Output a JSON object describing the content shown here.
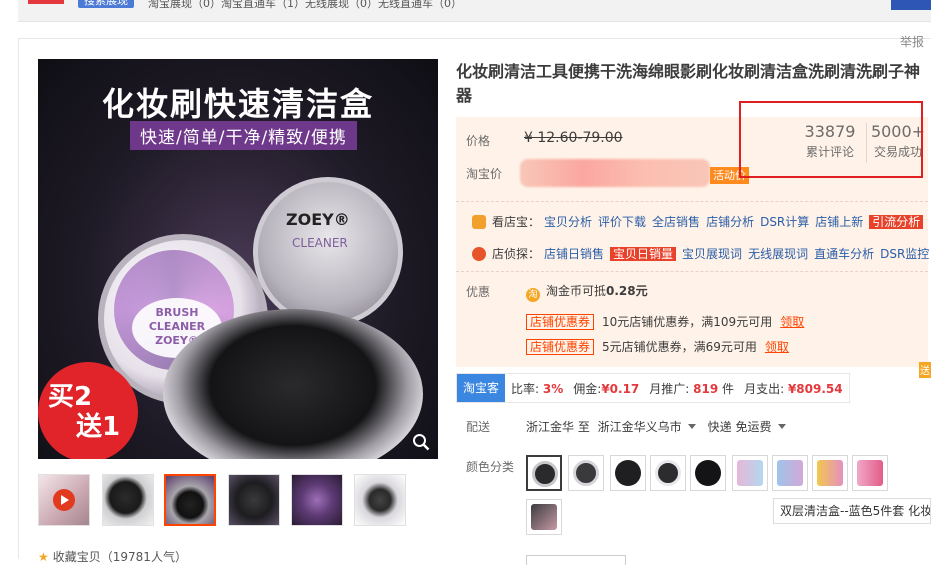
{
  "top_bar": {
    "search_chip": "搜索展现",
    "stats": "淘宝展现（0）淘宝直通车（1）无线展现（0）无线直通车（0）"
  },
  "report_link": "举报",
  "product_image": {
    "headline": "化妆刷快速清洁盒",
    "subline": "快速/简单/干净/精致/便携",
    "tin1_label_lines": [
      "BRUSH",
      "CLEANER",
      "ZOEY®"
    ],
    "tin2_brand": "ZOEY®",
    "tin2_text": "CLEANER",
    "badge_line1": "买2",
    "badge_line2": "送1"
  },
  "favorites": "收藏宝贝（19781人气）",
  "title": "化妆刷清洁工具便携干洗海绵眼影刷化妆刷清洁盒洗刷清洗刷子神器",
  "price": {
    "price_label": "价格",
    "original_price": "¥ 12.60-79.00",
    "taobao_price_label": "淘宝价",
    "event_tag": "活动价"
  },
  "stats": {
    "reviews_count": "33879",
    "reviews_label": "累计评论",
    "sales_count": "5000+",
    "sales_label": "交易成功"
  },
  "kandianbao": {
    "head": "看店宝：",
    "links": [
      "宝贝分析",
      "评价下载",
      "全店销售",
      "店铺分析",
      "DSR计算",
      "店铺上新"
    ],
    "highlight": "引流分析"
  },
  "dianzhentan": {
    "head": "店侦探：",
    "link1": "店铺日销售",
    "highlight": "宝贝日销量",
    "links": [
      "宝贝展现词",
      "无线展现词",
      "直通车分析",
      "DSR监控"
    ]
  },
  "promotion": {
    "label": "优惠",
    "coin_text": "淘金币可抵",
    "coin_value": "0.28元",
    "coupons": [
      {
        "tag": "店铺优惠券",
        "desc": "10元店铺优惠券，满109元可用",
        "action": "领取"
      },
      {
        "tag": "店铺优惠券",
        "desc": "5元店铺优惠券，满69元可用",
        "action": "领取"
      }
    ]
  },
  "taobaoke": {
    "brand": "淘宝客",
    "ratio_label": "比率:",
    "ratio_value": "3%",
    "commission_label": "佣金:",
    "commission_value": "¥0.17",
    "monthly_label": "月推广:",
    "monthly_value": "819",
    "monthly_unit": "件",
    "spend_label": "月支出:",
    "spend_value": "¥809.54"
  },
  "shipping": {
    "label": "配送",
    "origin": "浙江金华 至",
    "destination": "浙江金华义乌市",
    "method": "快递 免运费"
  },
  "colors": {
    "label": "颜色分类",
    "tooltip": "双层清洁盒--蓝色5件套 化妆"
  },
  "theme": {
    "accent": "#ff4400",
    "highlight_red": "#e4393c",
    "panel_bg": "#fff2e8",
    "link_blue": "#2a5ea8"
  }
}
